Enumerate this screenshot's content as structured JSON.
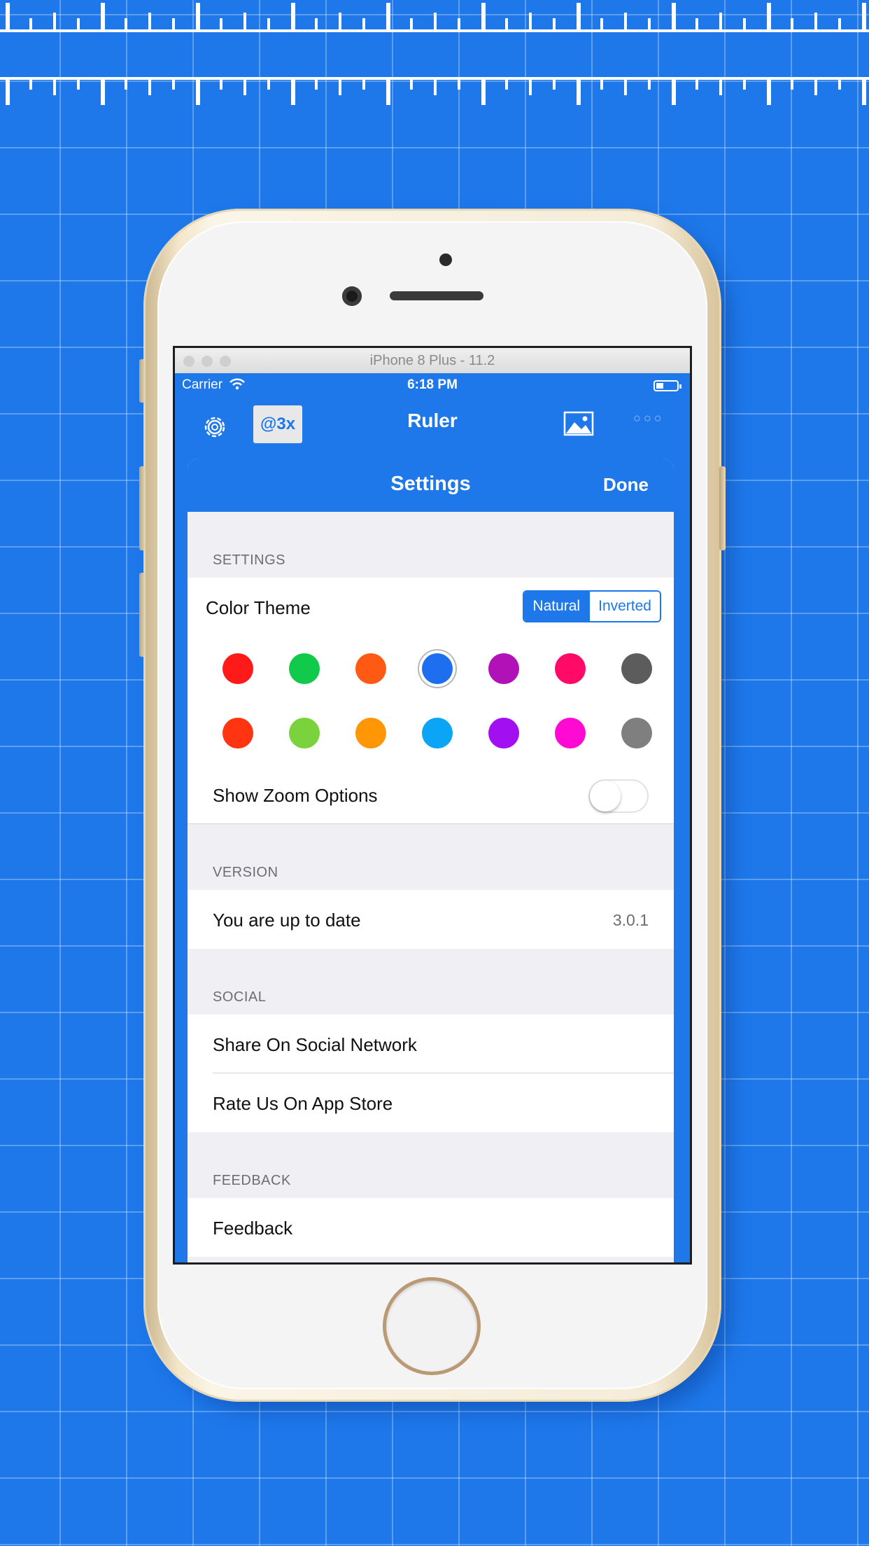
{
  "simulator": {
    "title": "iPhone 8 Plus - 11.2"
  },
  "status_bar": {
    "carrier": "Carrier",
    "time": "6:18 PM"
  },
  "nav": {
    "badge": "@3x",
    "title": "Ruler",
    "icons": [
      "gear-icon",
      "image-icon",
      "more-icon"
    ]
  },
  "sheet": {
    "title": "Settings",
    "done_label": "Done"
  },
  "sections": {
    "settings": {
      "header": "SETTINGS",
      "color_theme_label": "Color Theme",
      "segments": [
        "Natural",
        "Inverted"
      ],
      "selected_segment": "Natural",
      "colors_row1": [
        "#ff1a1a",
        "#11c94a",
        "#ff5a14",
        "#1e6ff0",
        "#b012b8",
        "#ff0a66",
        "#5c5c5c"
      ],
      "colors_row2": [
        "#ff3512",
        "#7ad23c",
        "#ff9605",
        "#0aa6f5",
        "#a20ff0",
        "#ff0ad2",
        "#7f7f7f"
      ],
      "selected_color": "#1e6ff0",
      "zoom_label": "Show Zoom Options",
      "zoom_enabled": false
    },
    "version": {
      "header": "VERSION",
      "label": "You are up to date",
      "value": "3.0.1"
    },
    "social": {
      "header": "SOCIAL",
      "items": [
        "Share On Social Network",
        "Rate Us On App Store"
      ]
    },
    "feedback": {
      "header": "FEEDBACK",
      "items": [
        "Feedback"
      ]
    }
  },
  "colors": {
    "accent": "#1e78ea",
    "background": "#1e78ea"
  }
}
